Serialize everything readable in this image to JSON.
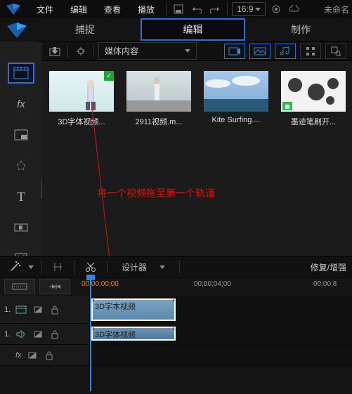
{
  "menubar": {
    "items": [
      "文件",
      "编辑",
      "查看",
      "播放"
    ],
    "aspect": "16:9",
    "rightText": "未命名"
  },
  "modeTabs": {
    "capture": "捕捉",
    "edit": "编辑",
    "produce": "制作"
  },
  "browserToolbar": {
    "mediaTypeLabel": "媒体内容"
  },
  "clips": [
    {
      "label": "3D字体视频...",
      "checked": true
    },
    {
      "label": "2911视频.m..."
    },
    {
      "label": "Kite Surfing...."
    },
    {
      "label": "墨迹笔刷开...",
      "badge": true
    }
  ],
  "annotation": "将一个视频拖至第一个轨道",
  "timelineTools": {
    "designerLabel": "设计器",
    "fixEnhance": "修复/增强"
  },
  "ruler": {
    "t0": "00;00;00;00",
    "t1": "00;00;04;00",
    "t2": "00;00;8"
  },
  "tracks": {
    "row1": {
      "num": "1."
    },
    "row2": {
      "num": "1."
    },
    "row3": {
      "fx": "fx"
    }
  },
  "clipBlocks": {
    "video": "3D字本视频",
    "audio": "3D字体视频"
  }
}
